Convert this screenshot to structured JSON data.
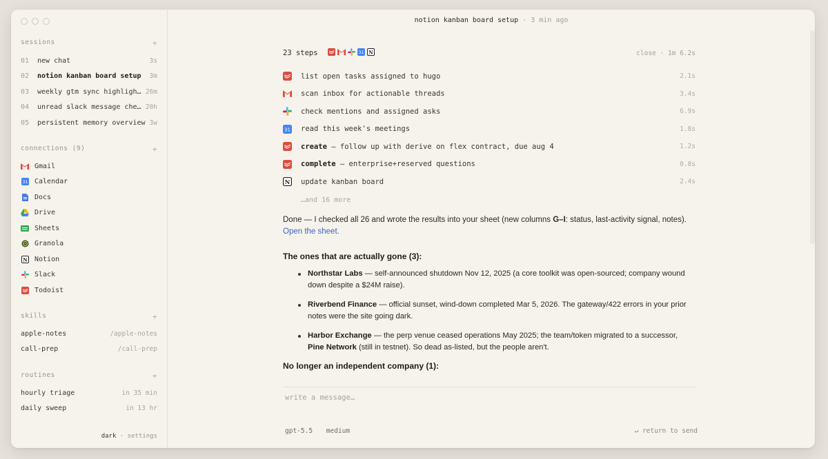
{
  "window": {
    "title": "notion kanban board setup",
    "title_ago": "· 3 min ago"
  },
  "sidebar": {
    "sessions_header": "sessions",
    "sessions": [
      {
        "num": "01",
        "label": "new chat",
        "meta": "3s"
      },
      {
        "num": "02",
        "label": "notion kanban board setup",
        "meta": "3m",
        "active": true
      },
      {
        "num": "03",
        "label": "weekly gtm sync highligh…",
        "meta": "26m"
      },
      {
        "num": "04",
        "label": "unread slack message che…",
        "meta": "20h"
      },
      {
        "num": "05",
        "label": "persistent memory overview",
        "meta": "3w"
      }
    ],
    "connections_header": "connections (9)",
    "connections": [
      {
        "label": "Gmail",
        "icon": "gmail-icon"
      },
      {
        "label": "Calendar",
        "icon": "calendar-icon"
      },
      {
        "label": "Docs",
        "icon": "docs-icon"
      },
      {
        "label": "Drive",
        "icon": "drive-icon"
      },
      {
        "label": "Sheets",
        "icon": "sheets-icon"
      },
      {
        "label": "Granola",
        "icon": "granola-icon"
      },
      {
        "label": "Notion",
        "icon": "notion-icon"
      },
      {
        "label": "Slack",
        "icon": "slack-icon"
      },
      {
        "label": "Todoist",
        "icon": "todoist-icon"
      }
    ],
    "skills_header": "skills",
    "skills": [
      {
        "label": "apple-notes",
        "meta": "/apple-notes"
      },
      {
        "label": "call-prep",
        "meta": "/call-prep"
      }
    ],
    "routines_header": "routines",
    "routines": [
      {
        "label": "hourly triage",
        "meta": "in 35 min"
      },
      {
        "label": "daily sweep",
        "meta": "in 13 hr"
      }
    ],
    "footer_theme": "dark",
    "footer_sep": "·",
    "footer_settings": "settings",
    "plus": "+"
  },
  "steps": {
    "count_label": "23 steps",
    "close": "close",
    "total": "· 1m 6.2s",
    "items": [
      {
        "icon": "todoist-icon",
        "bold": "",
        "text": "list open tasks assigned to hugo",
        "dur": "2.1s"
      },
      {
        "icon": "gmail-icon",
        "bold": "",
        "text": "scan inbox for actionable threads",
        "dur": "3.4s"
      },
      {
        "icon": "slack-icon",
        "bold": "",
        "text": "check mentions and assigned asks",
        "dur": "6.9s"
      },
      {
        "icon": "calendar-icon",
        "bold": "",
        "text": "read this week's meetings",
        "dur": "1.8s"
      },
      {
        "icon": "todoist-icon",
        "bold": "create",
        "text": " — follow up with derive on flex contract, due aug 4",
        "dur": "1.2s"
      },
      {
        "icon": "todoist-icon",
        "bold": "complete",
        "text": " — enterprise+reserved questions",
        "dur": "0.8s"
      },
      {
        "icon": "notion-icon",
        "bold": "",
        "text": "update kanban board",
        "dur": "2.4s"
      }
    ],
    "more": "…and 16 more"
  },
  "message": {
    "p1_a": "Done — I checked all 26 and wrote the results into your sheet (new columns ",
    "p1_b": "G–I",
    "p1_c": ": status, last-activity signal, notes).",
    "link": "Open the sheet.",
    "h1": "The ones that are actually gone (3):",
    "bullets": [
      {
        "b": "Northstar Labs",
        "t": " — self-announced shutdown Nov 12, 2025 (a core toolkit was open-sourced; company wound down despite a $24M raise)."
      },
      {
        "b": "Riverbend Finance",
        "t": " — official sunset, wind-down completed Mar 5, 2026. The gateway/422 errors in your prior notes were the site going dark."
      },
      {
        "b": "Harbor Exchange",
        "t": " — the perp venue ceased operations May 2025; the team/token migrated to a successor, ",
        "b2": "Pine Network",
        "t2": " (still in testnet). So dead as-listed, but the people aren't."
      }
    ],
    "h2": "No longer an independent company (1):"
  },
  "composer": {
    "placeholder": "write a message…",
    "model": "gpt-5.5",
    "effort": "medium",
    "send_hint": "↵ return to send"
  },
  "colors": {
    "accent_link": "#3b63c4",
    "todoist": "#db4c3f",
    "gmail": "#ea4335",
    "calendar": "#4285f4"
  }
}
